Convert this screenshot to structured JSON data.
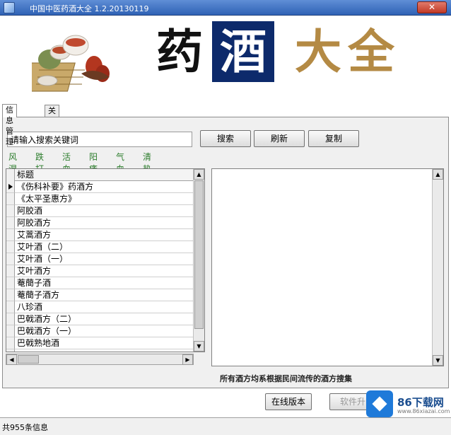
{
  "window": {
    "title": "中国中医药酒大全 1.2.20130119",
    "close_label": "✕"
  },
  "banner": {
    "chars": [
      "药",
      "酒",
      "大",
      "全"
    ]
  },
  "tabs": [
    {
      "label": "信息管理",
      "active": true
    },
    {
      "label": "关于我们",
      "active": false
    }
  ],
  "search": {
    "value": "请输入搜索关键词",
    "search_label": "搜索",
    "refresh_label": "刷新",
    "copy_label": "复制"
  },
  "categories": [
    "风湿",
    "跌打",
    "活血",
    "阳痿",
    "气血",
    "清热"
  ],
  "grid": {
    "header": "标题",
    "rows": [
      "《伤科补要》药酒方",
      "《太平圣惠方》",
      "阿胶酒",
      "阿胶酒方",
      "艾蒿酒方",
      "艾叶酒（二）",
      "艾叶酒（一）",
      "艾叶酒方",
      "菴蕳子酒",
      "菴蕳子酒方",
      "八珍酒",
      "巴戟酒方（二）",
      "巴戟酒方（一）",
      "巴戟熟地酒"
    ]
  },
  "footer_note": "所有酒方均系根据民间流传的酒方搜集",
  "buttons": {
    "online_label": "在线版本",
    "register_label": "软件升"
  },
  "status": {
    "text": "共955条信息"
  },
  "watermark": {
    "text": "86下载网",
    "sub": "www.86xiazai.com"
  }
}
